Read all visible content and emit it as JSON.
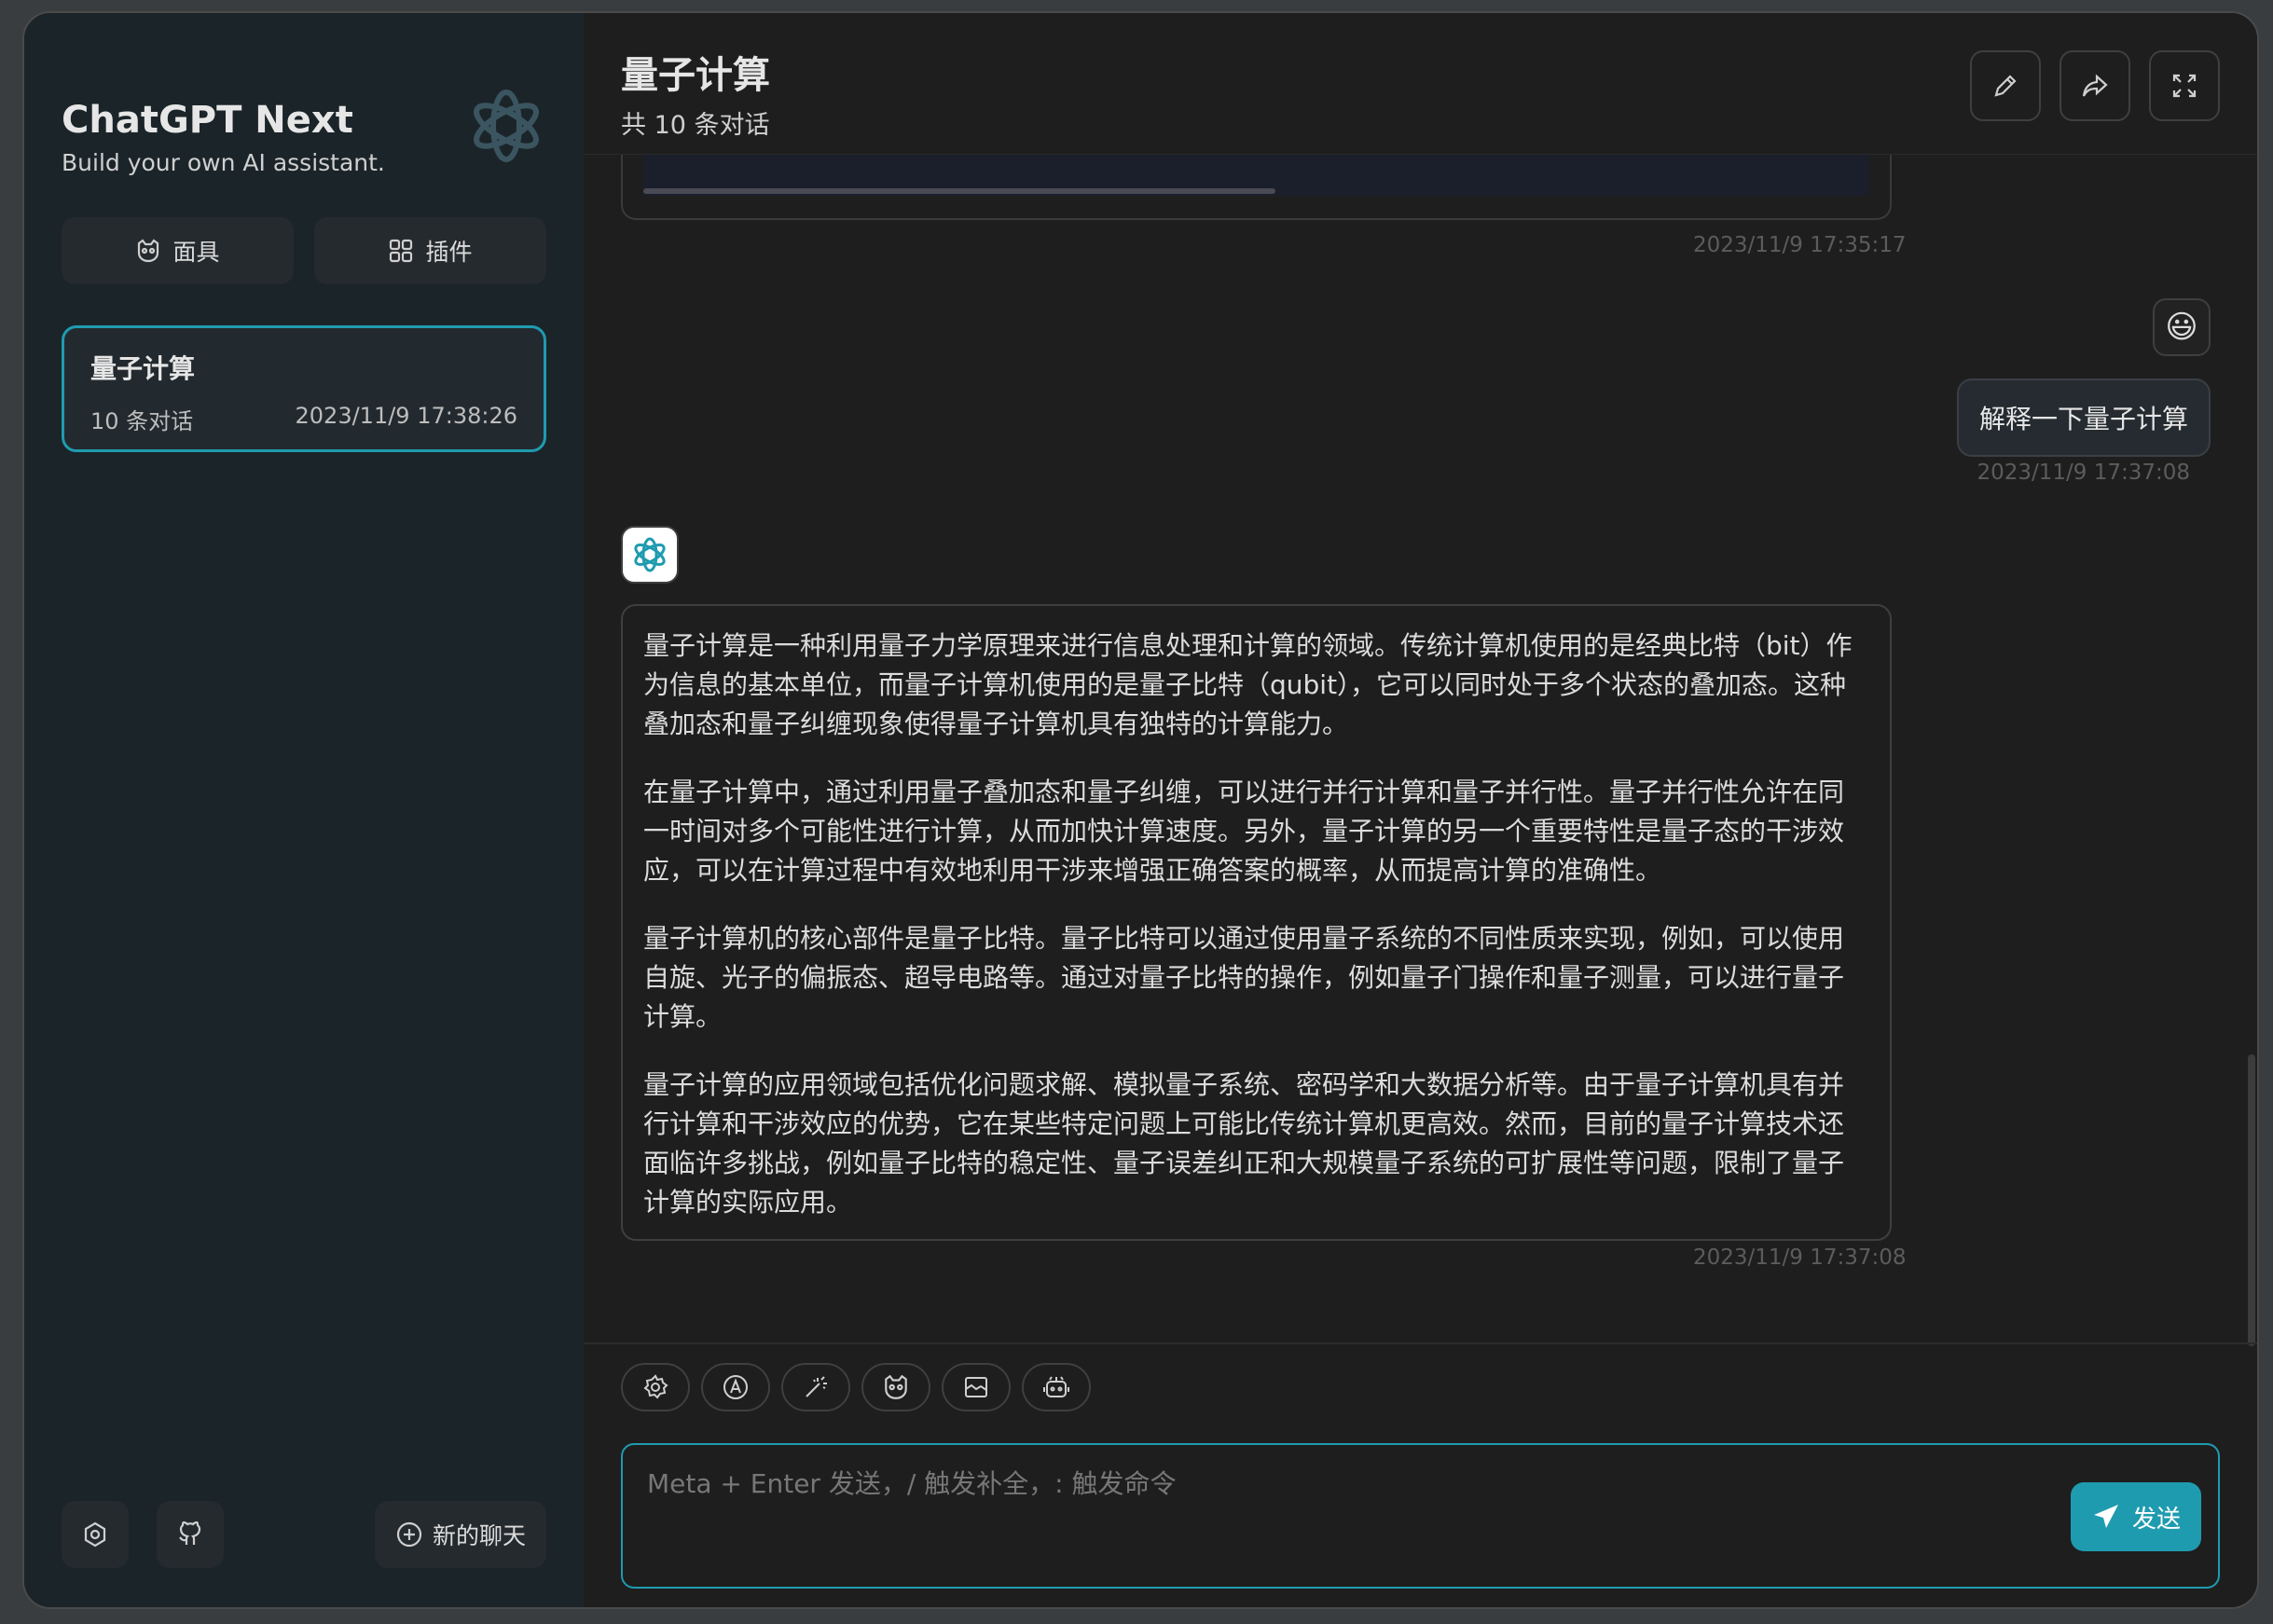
{
  "sidebar": {
    "brand_title": "ChatGPT Next",
    "brand_subtitle": "Build your own AI assistant.",
    "mask_label": "面具",
    "plugin_label": "插件",
    "chat_item": {
      "title": "量子计算",
      "count": "10 条对话",
      "time": "2023/11/9 17:38:26"
    },
    "new_chat_label": "新的聊天"
  },
  "header": {
    "title": "量子计算",
    "subtitle": "共 10 条对话"
  },
  "messages": {
    "prev_time": "2023/11/9 17:35:17",
    "user_emoji": "😃",
    "user_text": "解释一下量子计算",
    "user_time": "2023/11/9 17:37:08",
    "bot_paragraphs": [
      "量子计算是一种利用量子力学原理来进行信息处理和计算的领域。传统计算机使用的是经典比特（bit）作为信息的基本单位，而量子计算机使用的是量子比特（qubit），它可以同时处于多个状态的叠加态。这种叠加态和量子纠缠现象使得量子计算机具有独特的计算能力。",
      "在量子计算中，通过利用量子叠加态和量子纠缠，可以进行并行计算和量子并行性。量子并行性允许在同一时间对多个可能性进行计算，从而加快计算速度。另外，量子计算的另一个重要特性是量子态的干涉效应，可以在计算过程中有效地利用干涉来增强正确答案的概率，从而提高计算的准确性。",
      "量子计算机的核心部件是量子比特。量子比特可以通过使用量子系统的不同性质来实现，例如，可以使用自旋、光子的偏振态、超导电路等。通过对量子比特的操作，例如量子门操作和量子测量，可以进行量子计算。",
      "量子计算的应用领域包括优化问题求解、模拟量子系统、密码学和大数据分析等。由于量子计算机具有并行计算和干涉效应的优势，它在某些特定问题上可能比传统计算机更高效。然而，目前的量子计算技术还面临许多挑战，例如量子比特的稳定性、量子误差纠正和大规模量子系统的可扩展性等问题，限制了量子计算的实际应用。"
    ],
    "bot_time": "2023/11/9 17:37:08"
  },
  "input": {
    "placeholder": "Meta + Enter 发送，/ 触发补全，: 触发命令",
    "send_label": "发送"
  },
  "colors": {
    "accent": "#1f9bb0",
    "sidebar_bg": "#1b2429",
    "main_bg": "#1e1e1e"
  }
}
